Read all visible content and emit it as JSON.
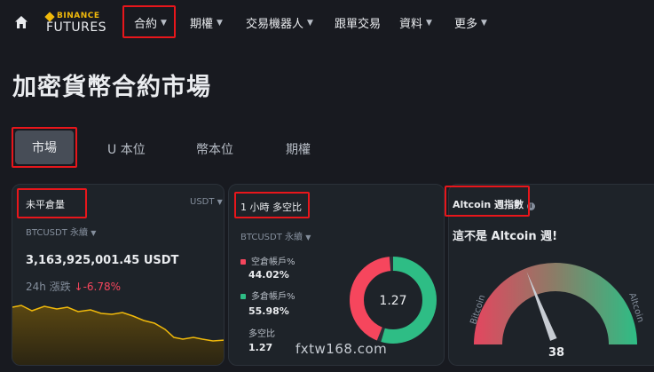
{
  "nav": {
    "logo_top": "BINANCE",
    "logo_bottom": "FUTURES",
    "items": [
      "合約",
      "期權",
      "交易機器人",
      "跟單交易",
      "資料",
      "更多"
    ]
  },
  "page": {
    "title": "加密貨幣合約市場"
  },
  "tabs": {
    "active": "市場",
    "items": [
      "U 本位",
      "幣本位",
      "期權"
    ]
  },
  "open_interest": {
    "title": "未平倉量",
    "unit_select": "USDT",
    "symbol": "BTCUSDT 永續",
    "value": "3,163,925,001.45 USDT",
    "change_label": "24h 漲跌",
    "change_value": "-6.78%"
  },
  "long_short": {
    "title": "1 小時 多空比",
    "symbol": "BTCUSDT 永續",
    "short_label": "空倉帳戶%",
    "short_value": "44.02%",
    "long_label": "多倉帳戶%",
    "long_value": "55.98%",
    "ratio_label": "多空比",
    "ratio_value": "1.27",
    "center_value": "1.27",
    "short_fraction": 0.4402,
    "long_fraction": 0.5598
  },
  "altcoin": {
    "title": "Altcoin 週指數",
    "headline": "這不是 Altcoin 週!",
    "left_label": "Bitcoin",
    "right_label": "Altcoin",
    "value": "38",
    "index": 38
  },
  "watermark": "fxtw168.com",
  "colors": {
    "short": "#f6465d",
    "long": "#2ebd85",
    "accent": "#f0b90b",
    "highlight": "#e8161b"
  }
}
